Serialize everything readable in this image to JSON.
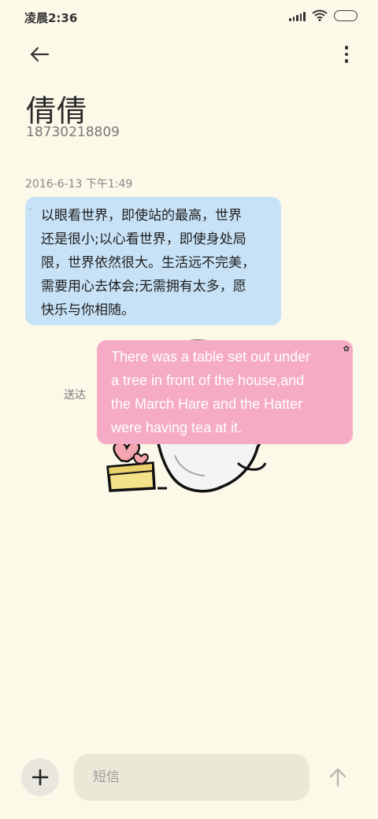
{
  "status_bar": {
    "time": "凌晨2:36",
    "icons": [
      "signal-icon",
      "wifi-icon",
      "battery-icon"
    ]
  },
  "header": {
    "back_icon": "arrow-left-icon",
    "more_icon": "more-vertical-icon",
    "contact_name": "倩倩",
    "contact_number": "18730218809"
  },
  "conversation": {
    "timestamp": "2016-6-13 下午1:49",
    "incoming": {
      "lines": [
        "以眼看世界，即使站的最高，世界",
        "还是很小;以心看世界，即使身处局",
        "限，世界依然很大。生活远不完美，",
        "需要用心去体会;无需拥有太多，愿",
        "快乐与你相随。"
      ],
      "color": "#c7e2f7"
    },
    "outgoing": {
      "lines": [
        "There was a table set out under",
        "a tree in front of the house,and",
        "the March Hare and the Hatter",
        "were having tea at it."
      ],
      "status": "送达",
      "color": "#f5abc5"
    }
  },
  "composer": {
    "add_icon": "plus-icon",
    "placeholder": "短信",
    "send_icon": "arrow-up-icon"
  },
  "colors": {
    "background": "#fcf9e9",
    "input_bg": "#ece8d8"
  }
}
